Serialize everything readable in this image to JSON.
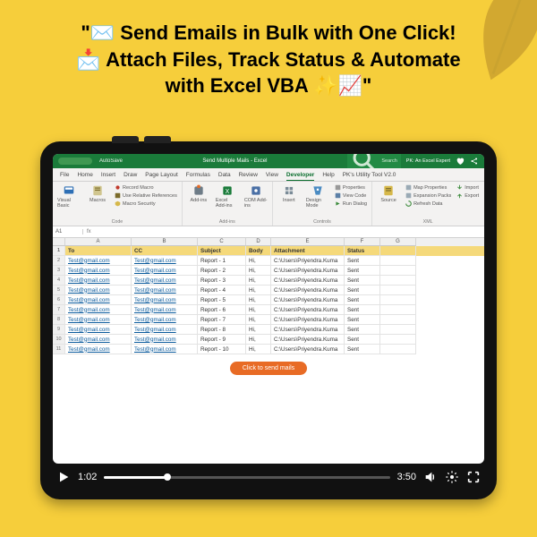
{
  "headline": {
    "line1": "\"✉️ Send Emails in Bulk with One Click!",
    "line2": "📩 Attach Files, Track Status & Automate",
    "line3": "with Excel VBA ✨📈\""
  },
  "titlebar": {
    "autosave": "AutoSave",
    "title": "Send Multiple Mails  -  Excel",
    "search_placeholder": "Search",
    "user": "PK: An Excel Expert"
  },
  "tabs": [
    "File",
    "Home",
    "Insert",
    "Draw",
    "Page Layout",
    "Formulas",
    "Data",
    "Review",
    "View",
    "Developer",
    "Help",
    "PK's Utility Tool V2.0"
  ],
  "active_tab": "Developer",
  "ribbon": {
    "code": {
      "name": "Code",
      "vb": "Visual Basic",
      "macros": "Macros",
      "rec": "Record Macro",
      "rel": "Use Relative References",
      "sec": "Macro Security"
    },
    "addins": {
      "name": "Add-ins",
      "addins": "Add-ins",
      "excel": "Excel Add-ins",
      "com": "COM Add-ins"
    },
    "controls": {
      "name": "Controls",
      "insert": "Insert",
      "design": "Design Mode",
      "props": "Properties",
      "code": "View Code",
      "run": "Run Dialog"
    },
    "xml": {
      "name": "XML",
      "source": "Source",
      "map": "Map Properties",
      "exp": "Expansion Packs",
      "ref": "Refresh Data",
      "import": "Import",
      "export": "Export"
    }
  },
  "formula_bar": {
    "cell": "A1",
    "fx": "fx"
  },
  "columns": [
    "",
    "A",
    "B",
    "C",
    "D",
    "E",
    "F",
    "G"
  ],
  "header_row": [
    "1",
    "To",
    "CC",
    "Subject",
    "Body",
    "Attachment",
    "Status",
    ""
  ],
  "rows": [
    [
      "2",
      "Test@gmail.com",
      "Test@gmail.com",
      "Report - 1",
      "Hi,",
      "C:\\Users\\Priyendra.Kuma",
      "Sent",
      ""
    ],
    [
      "3",
      "Test@gmail.com",
      "Test@gmail.com",
      "Report - 2",
      "Hi,",
      "C:\\Users\\Priyendra.Kuma",
      "Sent",
      ""
    ],
    [
      "4",
      "Test@gmail.com",
      "Test@gmail.com",
      "Report - 3",
      "Hi,",
      "C:\\Users\\Priyendra.Kuma",
      "Sent",
      ""
    ],
    [
      "5",
      "Test@gmail.com",
      "Test@gmail.com",
      "Report - 4",
      "Hi,",
      "C:\\Users\\Priyendra.Kuma",
      "Sent",
      ""
    ],
    [
      "6",
      "Test@gmail.com",
      "Test@gmail.com",
      "Report - 5",
      "Hi,",
      "C:\\Users\\Priyendra.Kuma",
      "Sent",
      ""
    ],
    [
      "7",
      "Test@gmail.com",
      "Test@gmail.com",
      "Report - 6",
      "Hi,",
      "C:\\Users\\Priyendra.Kuma",
      "Sent",
      ""
    ],
    [
      "8",
      "Test@gmail.com",
      "Test@gmail.com",
      "Report - 7",
      "Hi,",
      "C:\\Users\\Priyendra.Kuma",
      "Sent",
      ""
    ],
    [
      "9",
      "Test@gmail.com",
      "Test@gmail.com",
      "Report - 8",
      "Hi,",
      "C:\\Users\\Priyendra.Kuma",
      "Sent",
      ""
    ],
    [
      "10",
      "Test@gmail.com",
      "Test@gmail.com",
      "Report - 9",
      "Hi,",
      "C:\\Users\\Priyendra.Kuma",
      "Sent",
      ""
    ],
    [
      "11",
      "Test@gmail.com",
      "Test@gmail.com",
      "Report - 10",
      "Hi,",
      "C:\\Users\\Priyendra.Kuma",
      "Sent",
      ""
    ]
  ],
  "send_button": "Click to send mails",
  "video": {
    "current": "1:02",
    "duration": "3:50"
  }
}
